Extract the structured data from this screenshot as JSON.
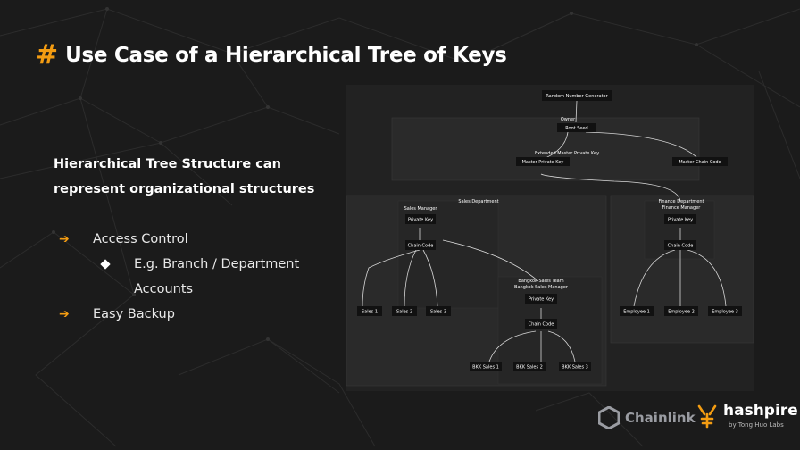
{
  "slide": {
    "hash": "#",
    "title": "Use Case of a Hierarchical Tree of Keys",
    "description_line1": "Hierarchical Tree Structure can",
    "description_line2": "represent organizational structures",
    "bullets": [
      {
        "arrow": "➔",
        "text": "Access Control"
      },
      {
        "text_line1": "E.g. Branch / Department",
        "text_line2": "Accounts"
      },
      {
        "arrow": "➔",
        "text": "Easy Backup"
      }
    ]
  },
  "diagram": {
    "nodes": [
      {
        "id": "rng",
        "label": "Random Number Generator"
      },
      {
        "id": "owner",
        "label": "Owner"
      },
      {
        "id": "root",
        "label": "Root Seed"
      },
      {
        "id": "empk_title",
        "label": "Extended Master Private Key"
      },
      {
        "id": "mpk",
        "label": "Master Private Key"
      },
      {
        "id": "mcc",
        "label": "Master Chain Code"
      },
      {
        "id": "sales_dept",
        "label": "Sales Department"
      },
      {
        "id": "sales_mgr",
        "label": "Sales Manager"
      },
      {
        "id": "sales_pk",
        "label": "Private Key"
      },
      {
        "id": "sales_cc",
        "label": "Chain Code"
      },
      {
        "id": "sales1",
        "label": "Sales 1"
      },
      {
        "id": "sales2",
        "label": "Sales 2"
      },
      {
        "id": "sales3",
        "label": "Sales 3"
      },
      {
        "id": "bkk_team",
        "label": "Bangkok Sales Team"
      },
      {
        "id": "bkk_mgr",
        "label": "Bangkok Sales Manager"
      },
      {
        "id": "bkk_pk",
        "label": "Private Key"
      },
      {
        "id": "bkk_cc",
        "label": "Chain Code"
      },
      {
        "id": "bkk1",
        "label": "BKK Sales 1"
      },
      {
        "id": "bkk2",
        "label": "BKK Sales 2"
      },
      {
        "id": "bkk3",
        "label": "BKK Sales 3"
      },
      {
        "id": "fin_dept",
        "label": "Finance Department"
      },
      {
        "id": "fin_mgr",
        "label": "Finance Manager"
      },
      {
        "id": "fin_pk",
        "label": "Private Key"
      },
      {
        "id": "fin_cc",
        "label": "Chain Code"
      },
      {
        "id": "emp1",
        "label": "Employee 1"
      },
      {
        "id": "emp2",
        "label": "Employee 2"
      },
      {
        "id": "emp3",
        "label": "Employee 3"
      }
    ]
  },
  "logos": {
    "chainlink": "Chainlink",
    "hashpire": "hashpire",
    "hashpire_sub": "by Tong Huo Labs"
  },
  "colors": {
    "accent": "#f39c12",
    "node_bg": "#111111",
    "panel_bg": "#222222",
    "line": "#d8d8d8"
  }
}
